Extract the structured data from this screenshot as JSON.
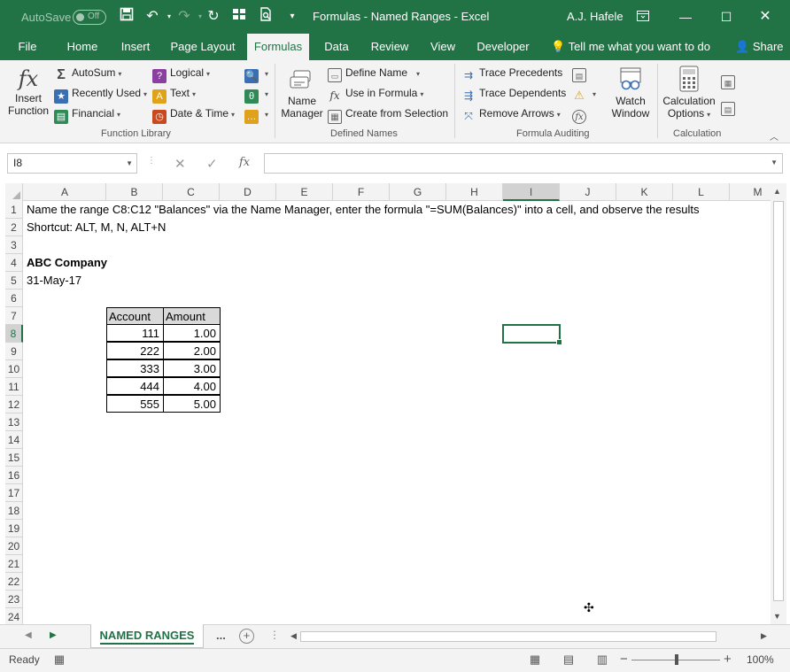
{
  "titlebar": {
    "autosave_label": "AutoSave",
    "autosave_state": "Off",
    "title": "Formulas - Named Ranges - Excel",
    "user": "A.J. Hafele"
  },
  "ribbon_tabs": [
    {
      "label": "File"
    },
    {
      "label": "Home"
    },
    {
      "label": "Insert"
    },
    {
      "label": "Page Layout"
    },
    {
      "label": "Formulas",
      "active": true
    },
    {
      "label": "Data"
    },
    {
      "label": "Review"
    },
    {
      "label": "View"
    },
    {
      "label": "Developer"
    }
  ],
  "tell_me": "Tell me what you want to do",
  "share": "Share",
  "ribbon": {
    "function_library": {
      "label": "Function Library",
      "insert_function": [
        "Insert",
        "Function"
      ],
      "autosum": "AutoSum",
      "recently_used": "Recently Used",
      "financial": "Financial",
      "logical": "Logical",
      "text": "Text",
      "date_time": "Date & Time"
    },
    "defined_names": {
      "label": "Defined Names",
      "name_manager": [
        "Name",
        "Manager"
      ],
      "define_name": "Define Name",
      "use_in_formula": "Use in Formula",
      "create_from_selection": "Create from Selection"
    },
    "formula_auditing": {
      "label": "Formula Auditing",
      "trace_precedents": "Trace Precedents",
      "trace_dependents": "Trace Dependents",
      "remove_arrows": "Remove Arrows",
      "watch_window": [
        "Watch",
        "Window"
      ]
    },
    "calculation": {
      "label": "Calculation",
      "calc_options": [
        "Calculation",
        "Options"
      ]
    }
  },
  "formula_bar": {
    "name_box": "I8",
    "formula": ""
  },
  "columns": [
    "A",
    "B",
    "C",
    "D",
    "E",
    "F",
    "G",
    "H",
    "I",
    "J",
    "K",
    "L",
    "M"
  ],
  "selected_column": "I",
  "rows": [
    "1",
    "2",
    "3",
    "4",
    "5",
    "6",
    "7",
    "8",
    "9",
    "10",
    "11",
    "12",
    "13",
    "14",
    "15",
    "16",
    "17",
    "18",
    "19",
    "20",
    "21",
    "22",
    "23",
    "24"
  ],
  "selected_row": "8",
  "sheet": {
    "a1": "Name the range C8:C12 \"Balances\" via the Name Manager, enter the formula \"=SUM(Balances)\" into a cell, and observe the results",
    "a2": "Shortcut: ALT, M, N, ALT+N",
    "a4": "ABC Company",
    "a5": "31-May-17",
    "table_headers": [
      "Account",
      "Amount"
    ],
    "table_rows": [
      {
        "account": "111",
        "amount": "1.00"
      },
      {
        "account": "222",
        "amount": "2.00"
      },
      {
        "account": "333",
        "amount": "3.00"
      },
      {
        "account": "444",
        "amount": "4.00"
      },
      {
        "account": "555",
        "amount": "5.00"
      }
    ]
  },
  "sheet_tabs": {
    "active": "NAMED RANGES",
    "more": "..."
  },
  "status": {
    "ready": "Ready",
    "zoom": "100%"
  }
}
